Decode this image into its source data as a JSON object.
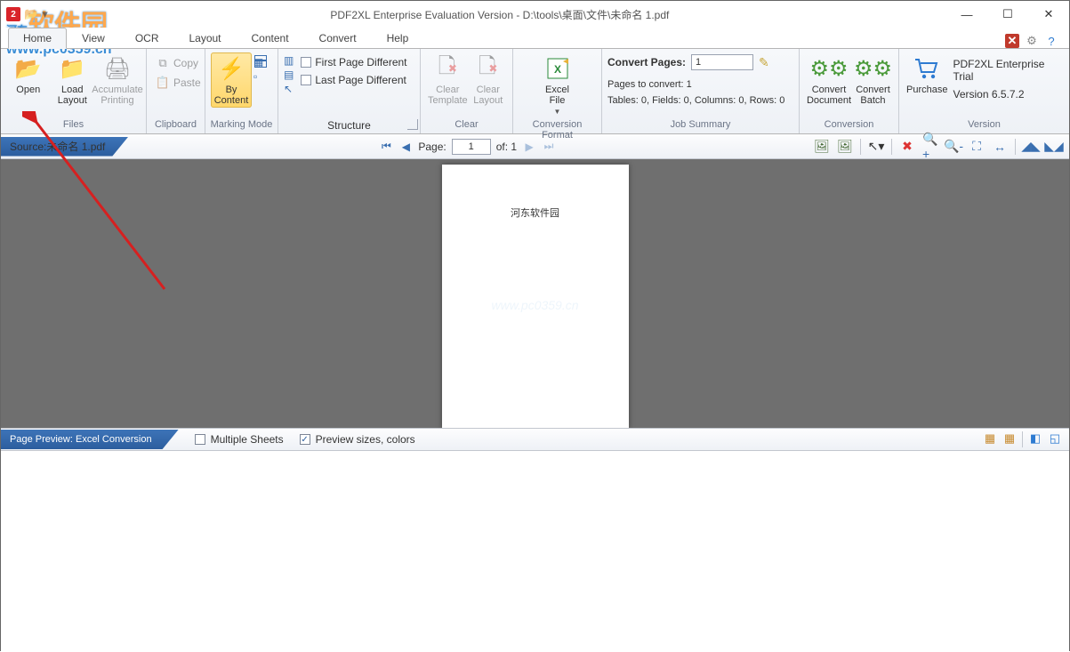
{
  "window": {
    "title": "PDF2XL Enterprise Evaluation Version - D:\\tools\\桌面\\文件\\未命名 1.pdf"
  },
  "watermark": {
    "brand_cn": "河东软件园",
    "url": "www.pc0359.cn"
  },
  "menu": {
    "tabs": [
      "Home",
      "View",
      "OCR",
      "Layout",
      "Content",
      "Convert",
      "Help"
    ],
    "active_index": 0
  },
  "ribbon": {
    "files": {
      "open": "Open",
      "load_layout": "Load\nLayout",
      "accumulate_printing": "Accumulate\nPrinting",
      "label": "Files"
    },
    "clipboard": {
      "copy": "Copy",
      "paste": "Paste",
      "label": "Clipboard"
    },
    "marking": {
      "by_content": "By\nContent",
      "label": "Marking Mode"
    },
    "structure": {
      "first_diff": "First Page Different",
      "last_diff": "Last Page Different",
      "label": "Structure"
    },
    "clear": {
      "clear_template": "Clear\nTemplate",
      "clear_layout": "Clear\nLayout",
      "label": "Clear"
    },
    "conv_format": {
      "excel_file": "Excel\nFile",
      "label": "Conversion Format"
    },
    "job": {
      "convert_pages_label": "Convert Pages:",
      "convert_pages_value": "1",
      "pages_to_convert": "Pages to convert: 1",
      "summary": "Tables: 0, Fields: 0, Columns: 0, Rows: 0",
      "label": "Job Summary"
    },
    "conversion": {
      "convert_document": "Convert\nDocument",
      "convert_batch": "Convert\nBatch",
      "label": "Conversion"
    },
    "version": {
      "purchase": "Purchase",
      "line1": "PDF2XL Enterprise Trial",
      "line2": "Version 6.5.7.2",
      "label": "Version"
    }
  },
  "subbar": {
    "source_prefix": "Source: ",
    "source_file": "未命名 1.pdf",
    "page_label": "Page:",
    "page_value": "1",
    "of_label": "of: 1"
  },
  "document": {
    "page_text": "河东软件园",
    "wm": "www.pc0359.cn"
  },
  "preview": {
    "title": "Page Preview: Excel Conversion",
    "multiple_sheets": "Multiple Sheets",
    "preview_sizes_colors": "Preview sizes, colors"
  }
}
